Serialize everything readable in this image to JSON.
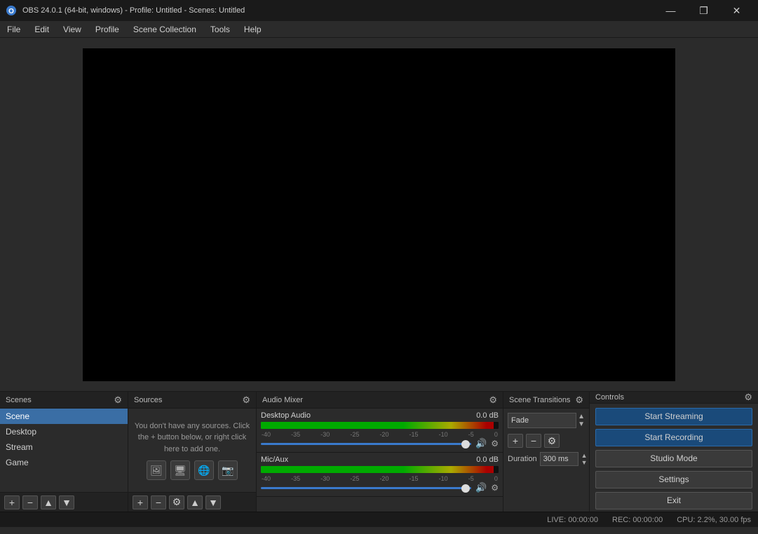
{
  "titlebar": {
    "title": "OBS 24.0.1 (64-bit, windows) - Profile: Untitled - Scenes: Untitled",
    "minimize": "—",
    "maximize": "❐",
    "close": "✕"
  },
  "menubar": {
    "items": [
      "File",
      "Edit",
      "View",
      "Profile",
      "Scene Collection",
      "Tools",
      "Help"
    ]
  },
  "panels": {
    "scenes": {
      "label": "Scenes",
      "items": [
        "Scene",
        "Desktop",
        "Stream",
        "Game"
      ]
    },
    "sources": {
      "label": "Sources",
      "empty_text": "You don't have any sources. Click the + button below, or right click here to add one."
    },
    "audio_mixer": {
      "label": "Audio Mixer",
      "tracks": [
        {
          "name": "Desktop Audio",
          "db": "0.0 dB",
          "scale": [
            "-40",
            "-35",
            "-30",
            "-25",
            "-20",
            "-15",
            "-10",
            "-5",
            "0"
          ]
        },
        {
          "name": "Mic/Aux",
          "db": "0.0 dB",
          "scale": [
            "-40",
            "-35",
            "-30",
            "-25",
            "-20",
            "-15",
            "-10",
            "-5",
            "0"
          ]
        }
      ]
    },
    "scene_transitions": {
      "label": "Scene Transitions",
      "transition_value": "Fade",
      "duration_label": "Duration",
      "duration_value": "300 ms"
    },
    "controls": {
      "label": "Controls",
      "buttons": {
        "start_streaming": "Start Streaming",
        "start_recording": "Start Recording",
        "studio_mode": "Studio Mode",
        "settings": "Settings",
        "exit": "Exit"
      }
    }
  },
  "statusbar": {
    "live_label": "LIVE:",
    "live_time": "00:00:00",
    "rec_label": "REC:",
    "rec_time": "00:00:00",
    "cpu_label": "CPU:",
    "cpu_value": "2.2%, 30.00 fps"
  }
}
